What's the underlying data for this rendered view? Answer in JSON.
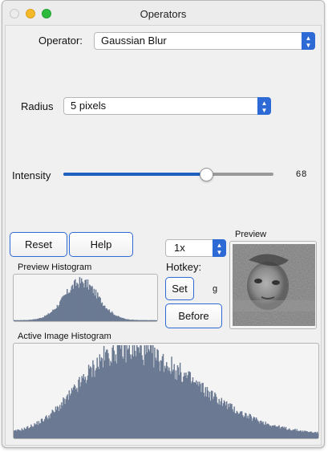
{
  "window": {
    "title": "Operators"
  },
  "operator": {
    "label": "Operator:",
    "value": "Gaussian Blur"
  },
  "radius": {
    "label": "Radius",
    "value": "5 pixels"
  },
  "intensity": {
    "label": "Intensity",
    "value": "68",
    "fraction": 0.68
  },
  "buttons": {
    "reset": "Reset",
    "help": "Help",
    "set": "Set",
    "before": "Before"
  },
  "zoom": {
    "value": "1x"
  },
  "hotkey": {
    "label": "Hotkey:",
    "key": "g"
  },
  "preview": {
    "label": "Preview"
  },
  "preview_histogram": {
    "label": "Preview Histogram"
  },
  "active_histogram": {
    "label": "Active Image Histogram"
  },
  "colors": {
    "accent": "#2e6ad6",
    "histogram": "#6b7a92",
    "slider_fill": "#1f5fbf"
  }
}
